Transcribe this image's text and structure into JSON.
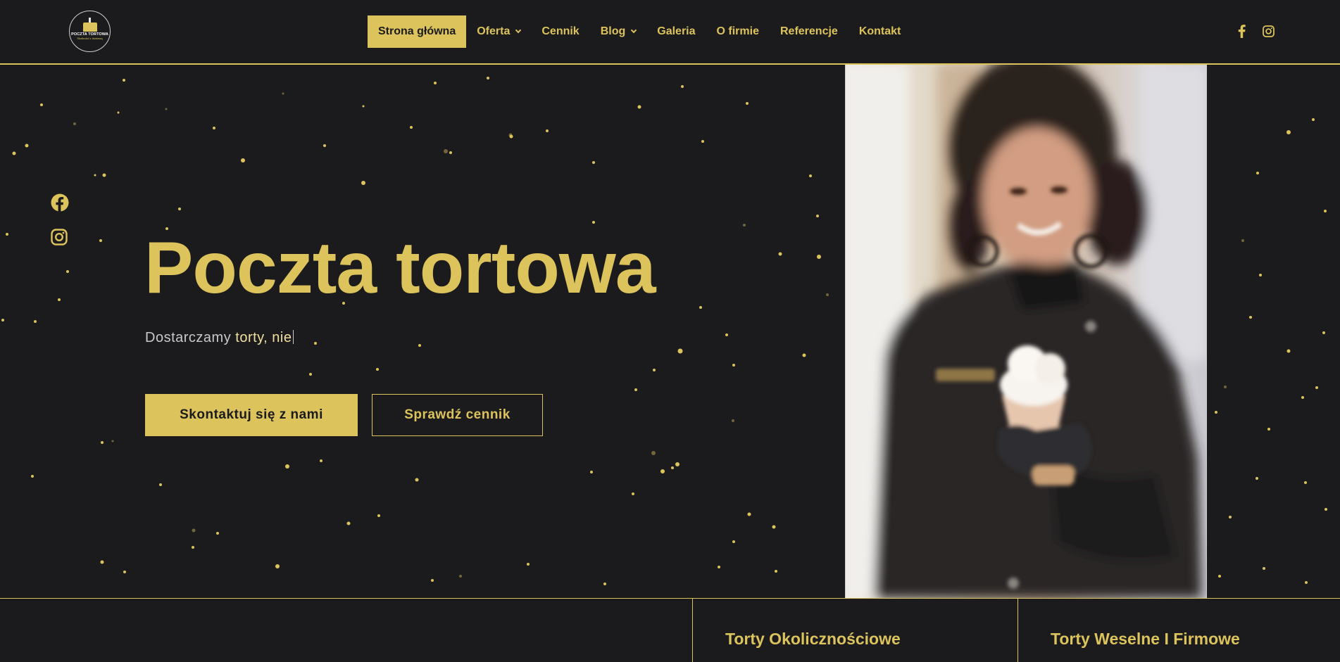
{
  "header": {
    "logo": {
      "title": "POCZTA TORTOWA",
      "subtitle": "Słodkości z dostawą",
      "icon": "cake-logo-icon"
    },
    "nav": [
      {
        "label": "Strona główna",
        "active": true,
        "dropdown": false
      },
      {
        "label": "Oferta",
        "active": false,
        "dropdown": true
      },
      {
        "label": "Cennik",
        "active": false,
        "dropdown": false
      },
      {
        "label": "Blog",
        "active": false,
        "dropdown": true
      },
      {
        "label": "Galeria",
        "active": false,
        "dropdown": false
      },
      {
        "label": "O firmie",
        "active": false,
        "dropdown": false
      },
      {
        "label": "Referencje",
        "active": false,
        "dropdown": false
      },
      {
        "label": "Kontakt",
        "active": false,
        "dropdown": false
      }
    ],
    "social_icons": [
      "facebook-icon",
      "instagram-icon"
    ]
  },
  "hero": {
    "side_social_icons": [
      "facebook-icon",
      "instagram-icon"
    ],
    "title": "Poczta tortowa",
    "subtitle_static": "Dostarczamy",
    "subtitle_typed": "torty, nie",
    "buttons": {
      "primary": "Skontaktuj się z nami",
      "secondary": "Sprawdź cennik"
    }
  },
  "cards": [
    {
      "title": "Torty Okolicznościowe"
    },
    {
      "title": "Torty Weselne I Firmowe"
    }
  ],
  "colors": {
    "background": "#1b1b1e",
    "accent": "#dcc35b",
    "text_muted": "#c9c9c9"
  }
}
